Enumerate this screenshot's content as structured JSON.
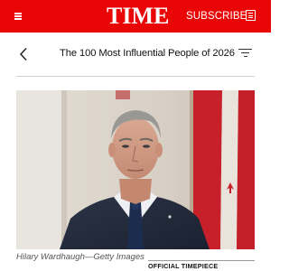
{
  "header": {
    "brand": "TIME",
    "subscribe_label": "SUBSCRIBE",
    "menu_icon": "hamburger-menu-icon",
    "subscribe_icon": "newspaper-icon",
    "background_color": "#e90606"
  },
  "title_bar": {
    "back_icon": "chevron-left-icon",
    "title": "The 100 Most Influential People of 2026",
    "filter_icon": "filter-icon"
  },
  "article": {
    "caption": "Hilary Wardhaugh—Getty Images",
    "sponsor_label": "OFFICIAL TIMEPIECE"
  }
}
